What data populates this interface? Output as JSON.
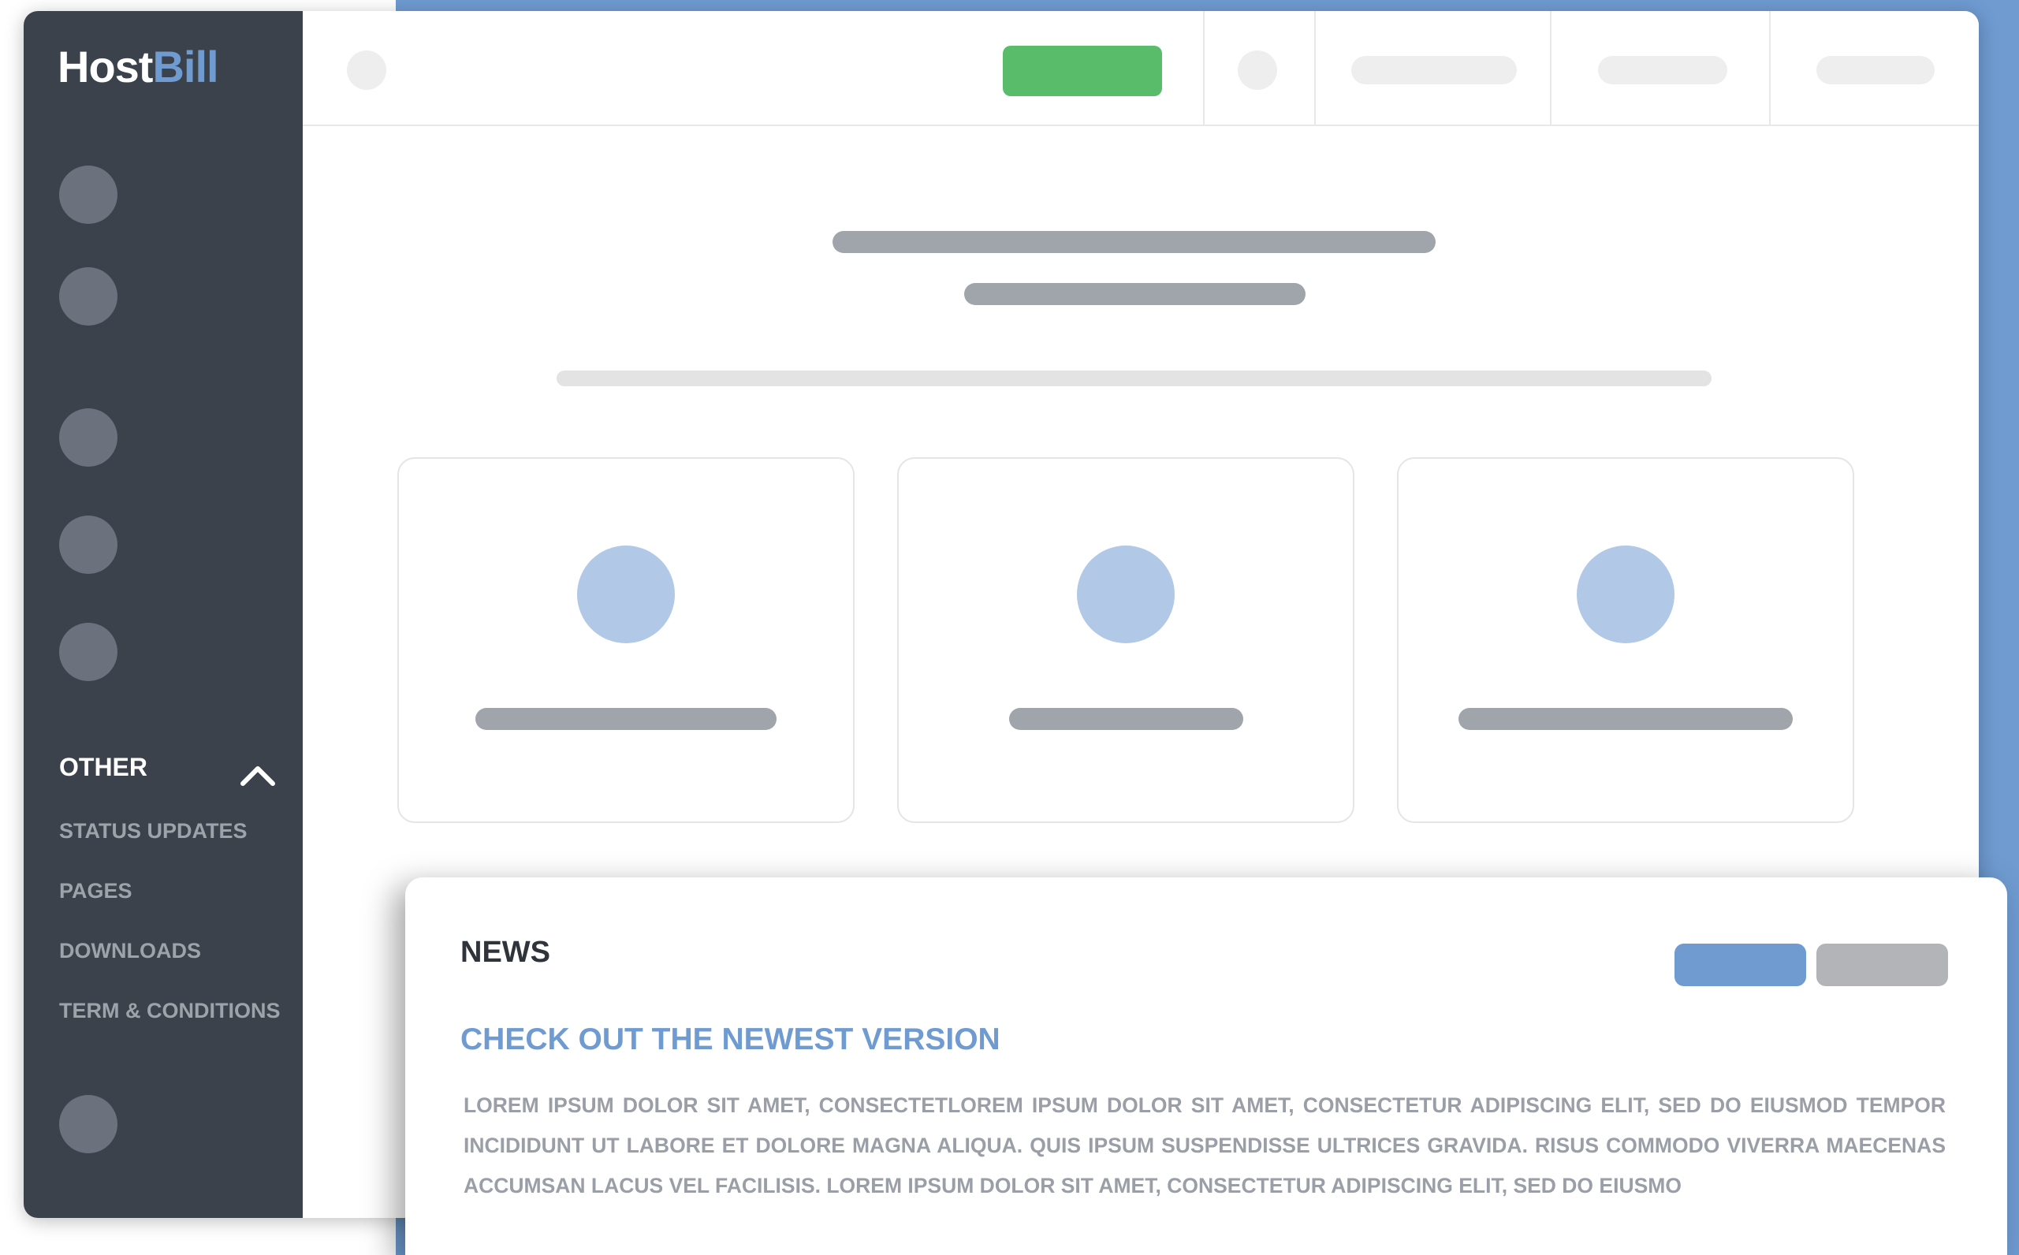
{
  "brand": {
    "logo_part1": "Host",
    "logo_part2": "Bill"
  },
  "sidebar": {
    "section_label": "OTHER",
    "items": [
      {
        "label": "STATUS UPDATES"
      },
      {
        "label": "PAGES"
      },
      {
        "label": "DOWNLOADS"
      },
      {
        "label": "TERM & CONDITIONS"
      }
    ]
  },
  "news": {
    "title": "NEWS",
    "headline": "CHECK OUT THE NEWEST VERSION",
    "body": "LOREM IPSUM DOLOR SIT AMET, CONSECTETLOREM IPSUM DOLOR SIT AMET, CONSECTETUR ADIPISCING ELIT, SED DO EIUSMOD TEMPOR INCIDIDUNT UT LABORE ET DOLORE MAGNA ALIQUA. QUIS IPSUM SUSPENDISSE ULTRICES GRAVIDA. RISUS COMMODO VIVERRA MAECENAS ACCUMSAN LACUS VEL FACILISIS. LOREM IPSUM DOLOR SIT AMET, CONSECTETUR ADIPISCING ELIT, SED DO EIUSMO"
  },
  "colors": {
    "accent": "#6f9bd1",
    "sidebar_bg": "#3b424c",
    "success": "#58bc6a",
    "placeholder": "#a0a4ab"
  },
  "icons": {
    "section_toggle": "chevron-up-icon"
  }
}
